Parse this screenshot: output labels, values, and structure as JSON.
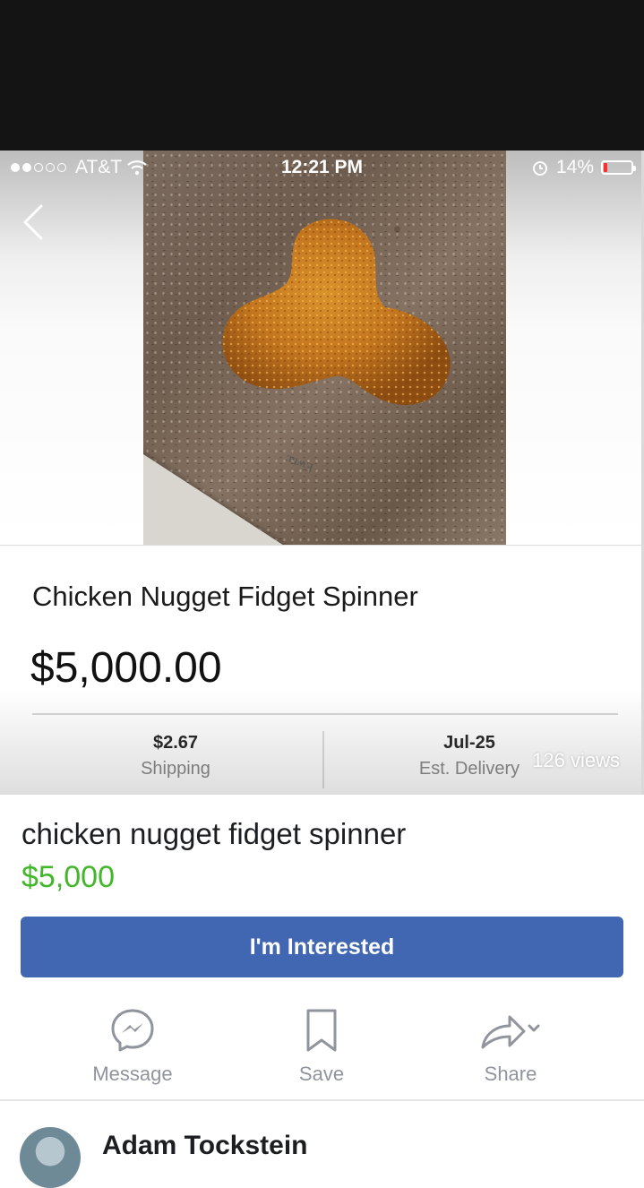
{
  "status_bar": {
    "carrier": "AT&T",
    "time": "12:21 PM",
    "battery": "14%",
    "battery_level": 0.14,
    "signal_bars": 2,
    "signal_total": 5
  },
  "icons": {
    "back": "chevron-left-icon",
    "wifi": "wifi-icon",
    "alarm": "alarm-icon",
    "battery": "battery-icon",
    "message": "messenger-icon",
    "save": "bookmark-icon",
    "share": "share-arrow-icon"
  },
  "embedded_listing": {
    "photo_label": "Ewta:",
    "title": "Chicken Nugget Fidget Spinner",
    "price": "$5,000.00",
    "shipping_value": "$2.67",
    "shipping_label": "Shipping",
    "delivery_value": "Jul-25",
    "delivery_label": "Est. Delivery"
  },
  "views": "126 views",
  "listing": {
    "title": "chicken nugget fidget spinner",
    "price": "$5,000",
    "interested_button": "I'm Interested"
  },
  "actions": {
    "message": "Message",
    "save": "Save",
    "share": "Share"
  },
  "seller": {
    "name": "Adam Tockstein"
  },
  "colors": {
    "fb_blue": "#4267b2",
    "price_green": "#42b72a",
    "battery_low": "#ff2d2d"
  }
}
